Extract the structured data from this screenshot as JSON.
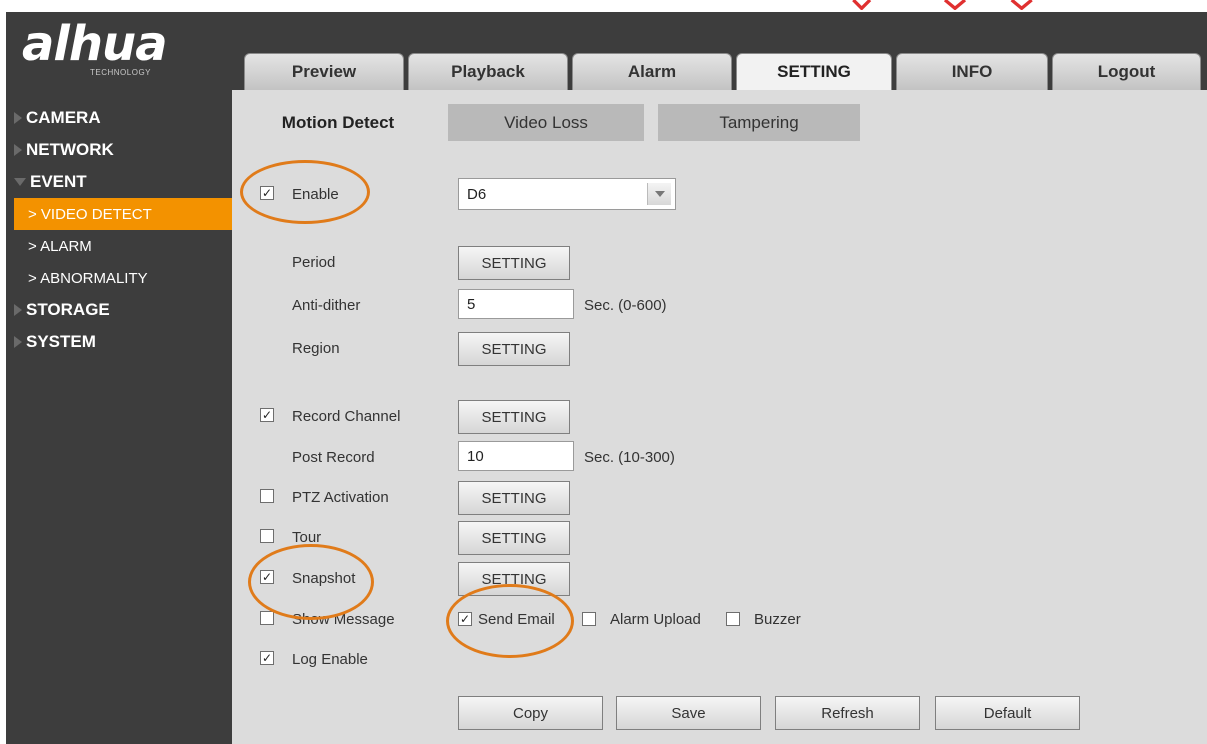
{
  "logo": {
    "brand": "alhua",
    "sub": "TECHNOLOGY"
  },
  "topnav": [
    "Preview",
    "Playback",
    "Alarm",
    "SETTING",
    "INFO",
    "Logout"
  ],
  "topnav_active": "SETTING",
  "sidebar": {
    "camera": "CAMERA",
    "network": "NETWORK",
    "event": "EVENT",
    "video_detect": "> VIDEO DETECT",
    "alarm": "> ALARM",
    "abnormality": "> ABNORMALITY",
    "storage": "STORAGE",
    "system": "SYSTEM"
  },
  "subtabs": [
    "Motion Detect",
    "Video Loss",
    "Tampering"
  ],
  "form": {
    "enable": {
      "label": "Enable",
      "checked": true
    },
    "channel": "D6",
    "period": {
      "label": "Period",
      "button": "SETTING"
    },
    "anti_dither": {
      "label": "Anti-dither",
      "value": "5",
      "unit": "Sec. (0-600)"
    },
    "region": {
      "label": "Region",
      "button": "SETTING"
    },
    "record_channel": {
      "label": "Record Channel",
      "checked": true,
      "button": "SETTING"
    },
    "post_record": {
      "label": "Post Record",
      "value": "10",
      "unit": "Sec. (10-300)"
    },
    "ptz_activation": {
      "label": "PTZ Activation",
      "checked": false,
      "button": "SETTING"
    },
    "tour": {
      "label": "Tour",
      "checked": false,
      "button": "SETTING"
    },
    "snapshot": {
      "label": "Snapshot",
      "checked": true,
      "button": "SETTING"
    },
    "show_message": {
      "label": "Show Message",
      "checked": false
    },
    "send_email": {
      "label": "Send Email",
      "checked": true
    },
    "alarm_upload": {
      "label": "Alarm Upload",
      "checked": false
    },
    "buzzer": {
      "label": "Buzzer",
      "checked": false
    },
    "log_enable": {
      "label": "Log Enable",
      "checked": true
    }
  },
  "actions": {
    "copy": "Copy",
    "save": "Save",
    "refresh": "Refresh",
    "default": "Default"
  },
  "check_glyph": "✓",
  "colors": {
    "accent": "#f39200",
    "highlight_circle": "#e07b1a",
    "background": "#3d3d3d"
  }
}
